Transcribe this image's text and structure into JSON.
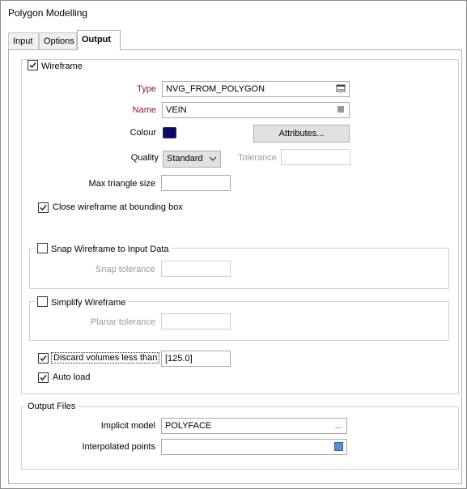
{
  "window": {
    "title": "Polygon Modelling"
  },
  "tabs": [
    {
      "label": "Input"
    },
    {
      "label": "Options"
    },
    {
      "label": "Output"
    }
  ],
  "wireframe": {
    "label": "Wireframe",
    "checked": true,
    "type_label": "Type",
    "type_value": "NVG_FROM_POLYGON",
    "name_label": "Name",
    "name_value": "VEIN",
    "colour_label": "Colour",
    "colour_value": "#0a0a6e",
    "attributes_button": "Attributes...",
    "quality_label": "Quality",
    "quality_value": "Standard",
    "tolerance_label": "Tolerance",
    "tolerance_value": "",
    "max_triangle_label": "Max triangle size",
    "max_triangle_value": "",
    "close_label": "Close wireframe at bounding box",
    "close_checked": true
  },
  "snap": {
    "label": "Snap Wireframe to Input Data",
    "checked": false,
    "tolerance_label": "Snap tolerance",
    "tolerance_value": ""
  },
  "simplify": {
    "label": "Simplify Wireframe",
    "checked": false,
    "planar_label": "Planar tolerance",
    "planar_value": ""
  },
  "discard": {
    "label": "Discard volumes less than",
    "checked": true,
    "value": "[125.0]"
  },
  "autoload": {
    "label": "Auto load",
    "checked": true
  },
  "output_files": {
    "label": "Output Files",
    "implicit_label": "Implicit model",
    "implicit_value": "POLYFACE",
    "interp_label": "Interpolated points",
    "interp_value": ""
  }
}
